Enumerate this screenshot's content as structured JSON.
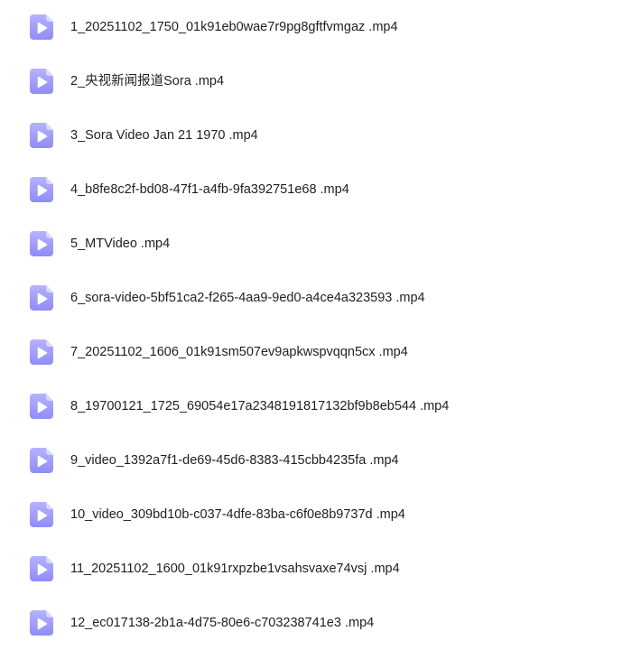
{
  "files": [
    {
      "name": "1_20251102_1750_01k91eb0wae7r9pg8gftfvmgaz .mp4",
      "icon": "video-file-icon"
    },
    {
      "name": "2_央视新闻报道Sora .mp4",
      "icon": "video-file-icon"
    },
    {
      "name": "3_Sora Video Jan 21 1970 .mp4",
      "icon": "video-file-icon"
    },
    {
      "name": "4_b8fe8c2f-bd08-47f1-a4fb-9fa392751e68 .mp4",
      "icon": "video-file-icon"
    },
    {
      "name": "5_MTVideo .mp4",
      "icon": "video-file-icon"
    },
    {
      "name": "6_sora-video-5bf51ca2-f265-4aa9-9ed0-a4ce4a323593 .mp4",
      "icon": "video-file-icon"
    },
    {
      "name": "7_20251102_1606_01k91sm507ev9apkwspvqqn5cx .mp4",
      "icon": "video-file-icon"
    },
    {
      "name": "8_19700121_1725_69054e17a2348191817132bf9b8eb544 .mp4",
      "icon": "video-file-icon"
    },
    {
      "name": "9_video_1392a7f1-de69-45d6-8383-415cbb4235fa .mp4",
      "icon": "video-file-icon"
    },
    {
      "name": "10_video_309bd10b-c037-4dfe-83ba-c6f0e8b9737d .mp4",
      "icon": "video-file-icon"
    },
    {
      "name": "11_20251102_1600_01k91rxpzbe1vsahsvaxe74vsj .mp4",
      "icon": "video-file-icon"
    },
    {
      "name": "12_ec017138-2b1a-4d75-80e6-c703238741e3 .mp4",
      "icon": "video-file-icon"
    }
  ],
  "colors": {
    "icon_gradient_top": "#b6b3ff",
    "icon_gradient_bottom": "#8f8cf6",
    "icon_fold": "#d9d7ff",
    "icon_play": "#ffffff",
    "text": "#1f1f1f"
  }
}
